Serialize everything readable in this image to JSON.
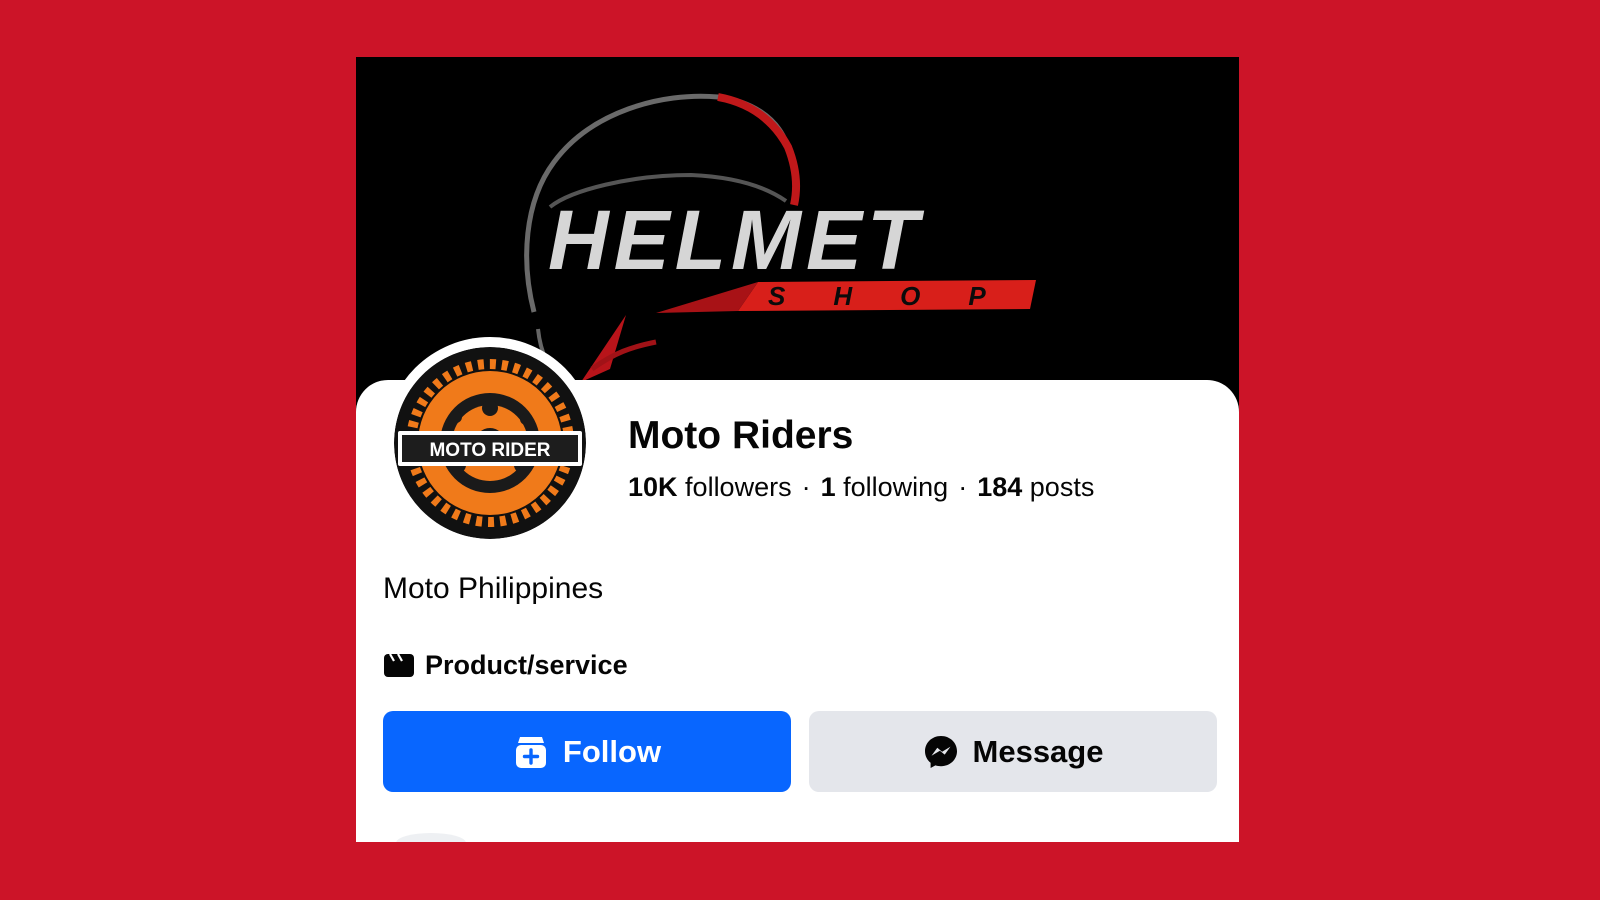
{
  "cover": {
    "title_text": "HELMET",
    "subtitle_text": "SHOP",
    "accent_color": "#e3241b"
  },
  "avatar": {
    "logo_text": "MOTO RIDER",
    "gear_color": "#f07a1a"
  },
  "profile": {
    "name": "Moto Riders",
    "stats": {
      "followers_count": "10K",
      "followers_label": "followers",
      "following_count": "1",
      "following_label": "following",
      "posts_count": "184",
      "posts_label": "posts",
      "separator": "·"
    },
    "bio": "Moto Philippines",
    "category": {
      "icon": "product-tag-icon",
      "label": "Product/service"
    }
  },
  "actions": {
    "follow": {
      "label": "Follow",
      "icon": "follow-page-icon",
      "color": "#0866ff"
    },
    "message": {
      "label": "Message",
      "icon": "messenger-icon",
      "color": "#e4e6eb"
    }
  },
  "colors": {
    "background": "#cc1428",
    "text_primary": "#050505"
  }
}
